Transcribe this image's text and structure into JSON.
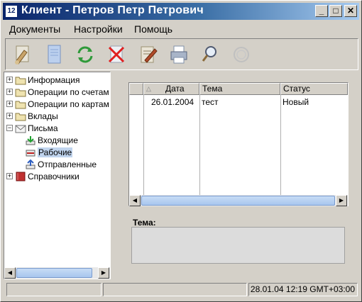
{
  "window": {
    "app_icon": "12",
    "title": "Клиент - Петров Петр Петрович",
    "min_glyph": "_",
    "max_glyph": "□",
    "close_glyph": "✕"
  },
  "menu": [
    "Документы",
    "Настройки",
    "Помощь"
  ],
  "toolbar": {
    "icons": [
      "new-document-icon",
      "document-icon",
      "refresh-icon",
      "delete-icon",
      "sign-icon",
      "print-icon",
      "search-icon",
      "stamp-icon"
    ]
  },
  "tree": {
    "items": [
      {
        "label": "Информация",
        "expander": "+"
      },
      {
        "label": "Операции по счетам",
        "expander": "+"
      },
      {
        "label": "Операции по картам",
        "expander": "+"
      },
      {
        "label": "Вклады",
        "expander": "+"
      },
      {
        "label": "Письма",
        "expander": "−"
      },
      {
        "label": "Входящие"
      },
      {
        "label": "Рабочие",
        "selected": true
      },
      {
        "label": "Отправленные"
      },
      {
        "label": "Справочники",
        "expander": "+"
      }
    ]
  },
  "table": {
    "columns": [
      "Дата",
      "Тема",
      "Статус"
    ],
    "rows": [
      {
        "date": "26.01.2004",
        "topic": "тест",
        "status": "Новый"
      }
    ]
  },
  "topic": {
    "label": "Тема:",
    "value": ""
  },
  "statusbar": {
    "datetime": "28.01.04 12:19 GMT+03:00"
  }
}
